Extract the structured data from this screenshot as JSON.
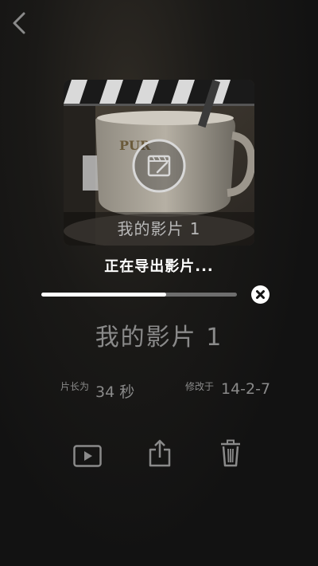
{
  "nav": {
    "back_icon": "chevron-left-icon"
  },
  "thumbnail": {
    "title": "我的影片 1",
    "overlay_icon": "clapperboard-icon"
  },
  "export": {
    "status": "正在导出影片...",
    "progress": 0.64,
    "cancel_icon": "close-icon"
  },
  "movie": {
    "title": "我的影片 1",
    "duration_label": "片长为",
    "duration_value": "34 秒",
    "modified_label": "修改于",
    "modified_value": "14-2-7"
  },
  "actions": [
    {
      "name": "play",
      "icon": "play-icon"
    },
    {
      "name": "share",
      "icon": "share-icon"
    },
    {
      "name": "delete",
      "icon": "trash-icon"
    }
  ],
  "colors": {
    "background": "#141414",
    "text_primary": "#ffffff",
    "text_muted": "#8a8a8a",
    "progress_track": "#6e6e6e"
  }
}
